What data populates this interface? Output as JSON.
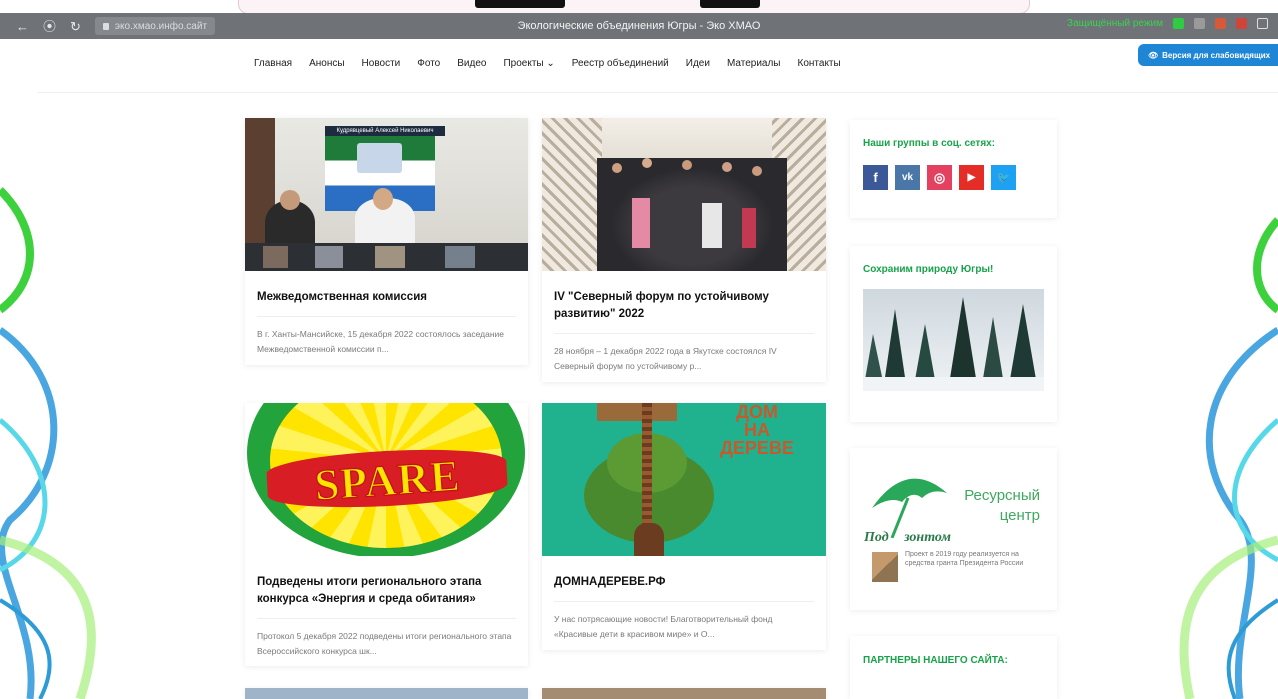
{
  "browser": {
    "url": "эко.хмао.инфо.сайт",
    "tab_title": "Экологические объединения Югры - Эко ХМАО",
    "reader_mode": "Защищённый режим"
  },
  "nav": {
    "items": [
      "Главная",
      "Анонсы",
      "Новости",
      "Фото",
      "Видео",
      "Проекты ⌄",
      "Реестр объединений",
      "Идеи",
      "Материалы",
      "Контакты"
    ]
  },
  "vision_button": "Версия для слабовидящих",
  "cards": [
    {
      "title": "Межведомственная комиссия",
      "excerpt": "В г. Ханты-Мансийске, 15 декабря 2022 состоялось заседание Межведомственной комиссии п...",
      "photo_caption": "Кудрявцевый Алексей Николаевич"
    },
    {
      "title": "IV \"Северный форум по устойчивому развитию\" 2022",
      "excerpt": "28 ноября – 1 декабря 2022 года в Якутске состоялся IV Северный форум по устойчивому р..."
    },
    {
      "title": "Подведены итоги регионального этапа конкурса «Энергия и среда обитания»",
      "excerpt": "Протокол 5 декабря 2022 подведены итоги регионального этапа Всероссийского конкурса шк...",
      "logo_text": "SPARE"
    },
    {
      "title": "ДОМНАДЕРЕВЕ.РФ",
      "excerpt": "У нас потрясающие новости! Благотворительный фонд «Красивые дети в красивом мире» и О...",
      "logo_text_1": "ДОМ",
      "logo_text_2": "НА",
      "logo_text_3": "ДЕРЕВЕ"
    }
  ],
  "sidebar": {
    "social_title": "Наши группы в соц. сетях:",
    "social": [
      {
        "icon": "facebook-icon",
        "glyph": "f",
        "color": "#3b5998"
      },
      {
        "icon": "vk-icon",
        "glyph": "vk",
        "color": "#4a76a8"
      },
      {
        "icon": "instagram-icon",
        "glyph": "◎",
        "color": "#e4405f"
      },
      {
        "icon": "youtube-icon",
        "glyph": "▶",
        "color": "#e52d27"
      },
      {
        "icon": "twitter-icon",
        "glyph": "🐦",
        "color": "#1da1f2"
      }
    ],
    "nature_title": "Сохраним природу Югры!",
    "resource": {
      "line1": "Ресурсный",
      "line2": "центр",
      "brand_a": "Под",
      "brand_b": "зонтом",
      "note": "Проект в 2019 году реализуется на средства гранта Президента России"
    },
    "partners_title": "ПАРТНЕРЫ НАШЕГО САЙТА:"
  },
  "colors": {
    "accent": "#17a34a",
    "button": "#1f86d6"
  }
}
